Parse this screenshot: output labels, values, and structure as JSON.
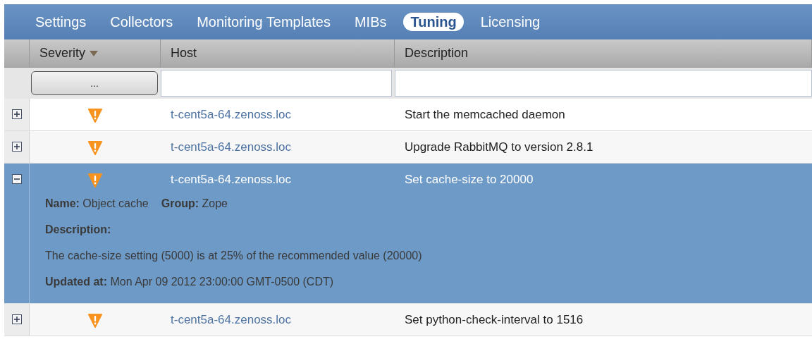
{
  "nav": [
    {
      "label": "Settings",
      "selected": false
    },
    {
      "label": "Collectors",
      "selected": false
    },
    {
      "label": "Monitoring Templates",
      "selected": false
    },
    {
      "label": "MIBs",
      "selected": false
    },
    {
      "label": "Tuning",
      "selected": true
    },
    {
      "label": "Licensing",
      "selected": false
    }
  ],
  "table": {
    "columns": [
      {
        "label": "Severity",
        "sorted": true
      },
      {
        "label": "Host",
        "sorted": false
      },
      {
        "label": "Description",
        "sorted": false
      }
    ],
    "filters": {
      "severity_button": "..."
    },
    "rows": [
      {
        "expanded": false,
        "selected": false,
        "host": "t-cent5a-64.zenoss.loc",
        "description": "Start the memcached daemon"
      },
      {
        "expanded": false,
        "selected": false,
        "host": "t-cent5a-64.zenoss.loc",
        "description": "Upgrade RabbitMQ to version 2.8.1"
      },
      {
        "expanded": true,
        "selected": true,
        "host": "t-cent5a-64.zenoss.loc",
        "description": "Set cache-size to 20000",
        "details": {
          "name": "**Name:** Object cache",
          "group": "**Group:** Zope",
          "description_label": "Description:",
          "description": "The cache-size setting (5000) is at 25% of the recommended value (20000)",
          "updated": "**Updated at:** Mon Apr 09 2012 23:00:00 GMT-0500 (CDT)"
        }
      },
      {
        "expanded": false,
        "selected": false,
        "host": "t-cent5a-64.zenoss.loc",
        "description": "Set python-check-interval to 1516"
      }
    ]
  }
}
